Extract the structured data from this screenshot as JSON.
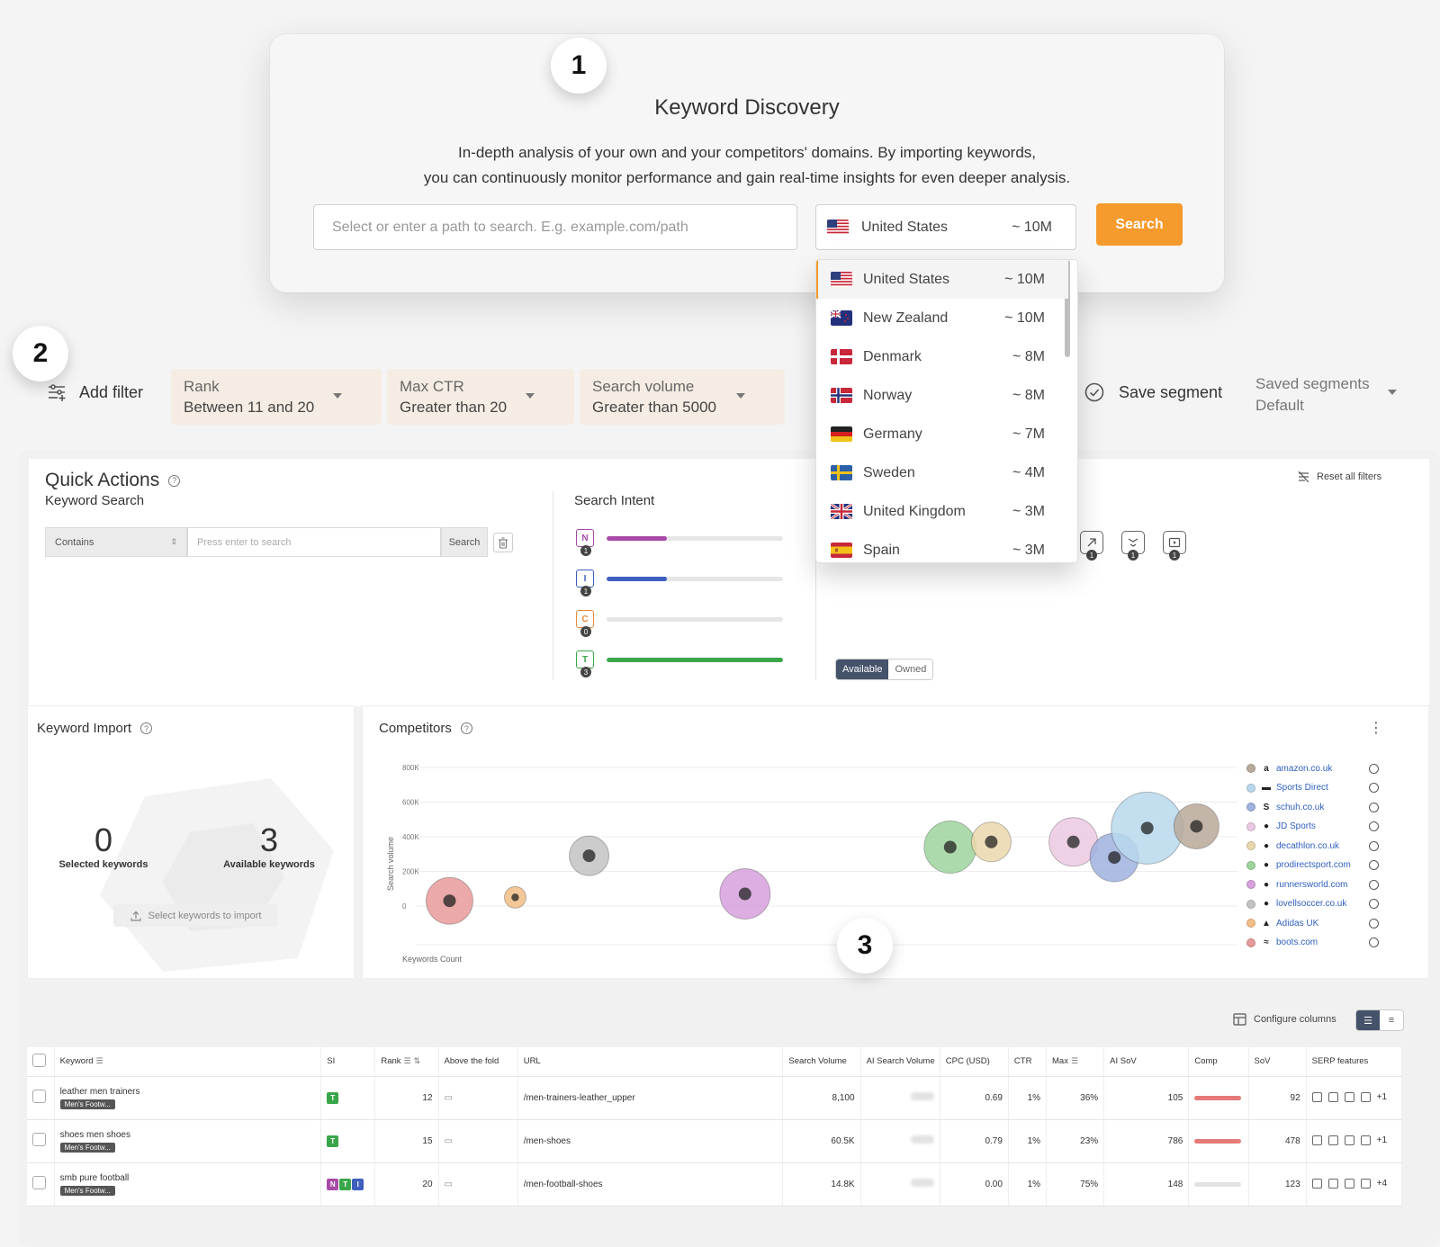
{
  "steps": {
    "one": "1",
    "two": "2",
    "three": "3"
  },
  "hero": {
    "title": "Keyword Discovery",
    "desc_line1": "In-depth analysis of your own and your competitors' domains. By importing keywords,",
    "desc_line2": "you can continuously monitor performance and gain real-time insights for even deeper analysis.",
    "path_placeholder": "Select or enter a path to search. E.g. example.com/path",
    "selected_country": "United States",
    "selected_volume": "~ 10M",
    "search_label": "Search"
  },
  "countries": [
    {
      "name": "United States",
      "volume": "~ 10M",
      "flag": "us"
    },
    {
      "name": "New Zealand",
      "volume": "~ 10M",
      "flag": "nz"
    },
    {
      "name": "Denmark",
      "volume": "~ 8M",
      "flag": "dk"
    },
    {
      "name": "Norway",
      "volume": "~ 8M",
      "flag": "no"
    },
    {
      "name": "Germany",
      "volume": "~ 7M",
      "flag": "de"
    },
    {
      "name": "Sweden",
      "volume": "~ 4M",
      "flag": "se"
    },
    {
      "name": "United Kingdom",
      "volume": "~ 3M",
      "flag": "gb"
    },
    {
      "name": "Spain",
      "volume": "~ 3M",
      "flag": "es"
    }
  ],
  "filters": {
    "add_filter": "Add filter",
    "chips": [
      {
        "label": "Rank",
        "value": "Between 11 and 20"
      },
      {
        "label": "Max CTR",
        "value": "Greater than 20"
      },
      {
        "label": "Search volume",
        "value": "Greater than 5000"
      }
    ],
    "save_segment": "Save segment",
    "saved_segments_label": "Saved segments",
    "saved_segments_value": "Default"
  },
  "quick_actions": {
    "title": "Quick Actions",
    "help": "?",
    "reset_filters": "Reset all filters",
    "keyword_search": {
      "title": "Keyword Search",
      "match_type": "Contains",
      "placeholder": "Press enter to search",
      "button": "Search"
    },
    "search_intent": {
      "title": "Search Intent",
      "rows": [
        {
          "letter": "N",
          "count": "1",
          "fill": 0.34,
          "color": "#a84aa8"
        },
        {
          "letter": "I",
          "count": "1",
          "fill": 0.34,
          "color": "#3f5fbf"
        },
        {
          "letter": "C",
          "count": "0",
          "fill": 0,
          "color": "#e8893a"
        },
        {
          "letter": "T",
          "count": "3",
          "fill": 1.0,
          "color": "#3aa64a"
        }
      ]
    },
    "serp_counts": [
      "1",
      "1",
      "1"
    ],
    "toggle": {
      "on": "Available",
      "off": "Owned"
    }
  },
  "keyword_import": {
    "title": "Keyword Import",
    "selected_count": "0",
    "selected_label": "Selected keywords",
    "available_count": "3",
    "available_label": "Available keywords",
    "button": "Select keywords to import"
  },
  "competitors": {
    "title": "Competitors",
    "menu": "⋮",
    "legend": [
      {
        "name": "amazon.co.uk",
        "color": "#b9a99a",
        "icon": "a"
      },
      {
        "name": "Sports Direct",
        "color": "#b7d8ec",
        "icon": "▬"
      },
      {
        "name": "schuh.co.uk",
        "color": "#9fb1de",
        "icon": "S"
      },
      {
        "name": "JD Sports",
        "color": "#ecc9e2",
        "icon": "●"
      },
      {
        "name": "decathlon.co.uk",
        "color": "#ead8ad",
        "icon": "●"
      },
      {
        "name": "prodirectsport.com",
        "color": "#9ed49e",
        "icon": "●"
      },
      {
        "name": "runnersworld.com",
        "color": "#d6a0dc",
        "icon": "●"
      },
      {
        "name": "lovellsoccer.co.uk",
        "color": "#c3c3c3",
        "icon": "●"
      },
      {
        "name": "Adidas UK",
        "color": "#f2bd86",
        "icon": "▲"
      },
      {
        "name": "boots.com",
        "color": "#e79a9a",
        "icon": "≈"
      }
    ]
  },
  "chart_data": {
    "type": "scatter",
    "xlabel": "Keywords Count",
    "ylabel": "Search volume",
    "y_ticks": [
      "0",
      "200K",
      "400K",
      "600K",
      "800K"
    ],
    "ylim": [
      0,
      800000
    ],
    "points": [
      {
        "name": "boots.com",
        "x": 0.04,
        "y": 30000,
        "size": 26,
        "color": "#e79a9a"
      },
      {
        "name": "Adidas UK",
        "x": 0.12,
        "y": 50000,
        "size": 12,
        "color": "#f2bd86"
      },
      {
        "name": "lovellsoccer.co.uk",
        "x": 0.21,
        "y": 290000,
        "size": 22,
        "color": "#c3c3c3"
      },
      {
        "name": "runnersworld.com",
        "x": 0.4,
        "y": 70000,
        "size": 28,
        "color": "#d6a0dc"
      },
      {
        "name": "prodirectsport.com",
        "x": 0.65,
        "y": 340000,
        "size": 29,
        "color": "#9ed49e"
      },
      {
        "name": "decathlon.co.uk",
        "x": 0.7,
        "y": 370000,
        "size": 22,
        "color": "#ead8ad"
      },
      {
        "name": "JD Sports",
        "x": 0.8,
        "y": 370000,
        "size": 27,
        "color": "#ecc9e2"
      },
      {
        "name": "schuh.co.uk",
        "x": 0.85,
        "y": 280000,
        "size": 27,
        "color": "#9fb1de"
      },
      {
        "name": "Sports Direct",
        "x": 0.89,
        "y": 450000,
        "size": 40,
        "color": "#b7d8ec"
      },
      {
        "name": "amazon.co.uk",
        "x": 0.95,
        "y": 460000,
        "size": 25,
        "color": "#b9a99a"
      }
    ]
  },
  "table": {
    "configure_columns": "Configure columns",
    "columns": [
      "Keyword",
      "SI",
      "Rank",
      "Above the fold",
      "URL",
      "Search Volume",
      "AI Search Volume",
      "CPC (USD)",
      "CTR",
      "Max",
      "AI SoV",
      "Comp",
      "SoV",
      "SERP features"
    ],
    "rows": [
      {
        "keyword": "leather men trainers",
        "tag": "Men's Footw...",
        "si": [
          "T"
        ],
        "rank": "12",
        "url": "/men-trainers-leather_upper",
        "sv": "8,100",
        "cpc": "0.69",
        "ctr": "1%",
        "max": "36%",
        "aisov": "105",
        "comp": 1,
        "sov": "92",
        "more": "+1"
      },
      {
        "keyword": "shoes men shoes",
        "tag": "Men's Footw...",
        "si": [
          "T"
        ],
        "rank": "15",
        "url": "/men-shoes",
        "sv": "60.5K",
        "cpc": "0.79",
        "ctr": "1%",
        "max": "23%",
        "aisov": "786",
        "comp": 1,
        "sov": "478",
        "more": "+1"
      },
      {
        "keyword": "smb pure football",
        "tag": "Men's Footw...",
        "si": [
          "N",
          "T",
          "I"
        ],
        "rank": "20",
        "url": "/men-football-shoes",
        "sv": "14.8K",
        "cpc": "0.00",
        "ctr": "1%",
        "max": "75%",
        "aisov": "148",
        "comp": 0,
        "sov": "123",
        "more": "+4"
      }
    ]
  }
}
